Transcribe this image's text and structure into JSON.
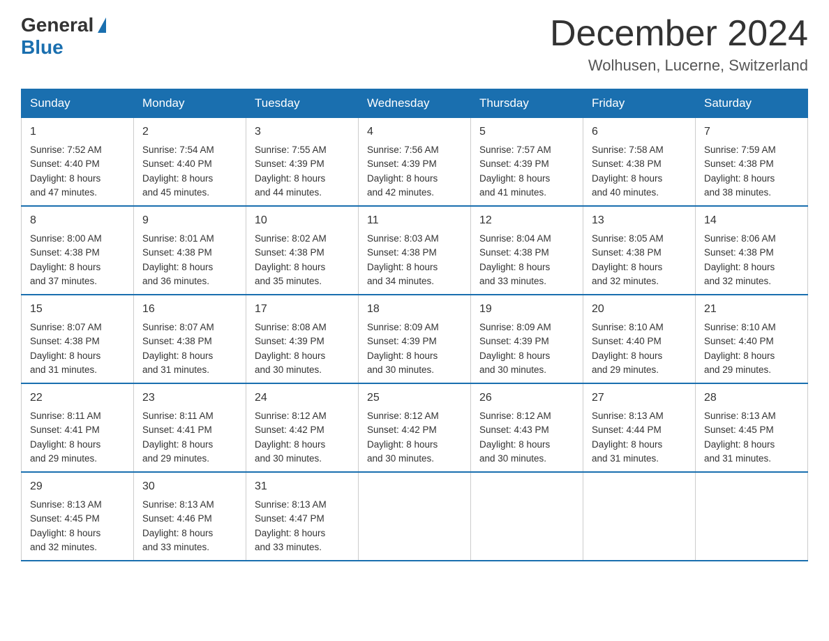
{
  "header": {
    "logo_general": "General",
    "logo_blue": "Blue",
    "title": "December 2024",
    "subtitle": "Wolhusen, Lucerne, Switzerland"
  },
  "weekdays": [
    "Sunday",
    "Monday",
    "Tuesday",
    "Wednesday",
    "Thursday",
    "Friday",
    "Saturday"
  ],
  "weeks": [
    [
      {
        "day": "1",
        "sunrise": "7:52 AM",
        "sunset": "4:40 PM",
        "daylight": "8 hours and 47 minutes."
      },
      {
        "day": "2",
        "sunrise": "7:54 AM",
        "sunset": "4:40 PM",
        "daylight": "8 hours and 45 minutes."
      },
      {
        "day": "3",
        "sunrise": "7:55 AM",
        "sunset": "4:39 PM",
        "daylight": "8 hours and 44 minutes."
      },
      {
        "day": "4",
        "sunrise": "7:56 AM",
        "sunset": "4:39 PM",
        "daylight": "8 hours and 42 minutes."
      },
      {
        "day": "5",
        "sunrise": "7:57 AM",
        "sunset": "4:39 PM",
        "daylight": "8 hours and 41 minutes."
      },
      {
        "day": "6",
        "sunrise": "7:58 AM",
        "sunset": "4:38 PM",
        "daylight": "8 hours and 40 minutes."
      },
      {
        "day": "7",
        "sunrise": "7:59 AM",
        "sunset": "4:38 PM",
        "daylight": "8 hours and 38 minutes."
      }
    ],
    [
      {
        "day": "8",
        "sunrise": "8:00 AM",
        "sunset": "4:38 PM",
        "daylight": "8 hours and 37 minutes."
      },
      {
        "day": "9",
        "sunrise": "8:01 AM",
        "sunset": "4:38 PM",
        "daylight": "8 hours and 36 minutes."
      },
      {
        "day": "10",
        "sunrise": "8:02 AM",
        "sunset": "4:38 PM",
        "daylight": "8 hours and 35 minutes."
      },
      {
        "day": "11",
        "sunrise": "8:03 AM",
        "sunset": "4:38 PM",
        "daylight": "8 hours and 34 minutes."
      },
      {
        "day": "12",
        "sunrise": "8:04 AM",
        "sunset": "4:38 PM",
        "daylight": "8 hours and 33 minutes."
      },
      {
        "day": "13",
        "sunrise": "8:05 AM",
        "sunset": "4:38 PM",
        "daylight": "8 hours and 32 minutes."
      },
      {
        "day": "14",
        "sunrise": "8:06 AM",
        "sunset": "4:38 PM",
        "daylight": "8 hours and 32 minutes."
      }
    ],
    [
      {
        "day": "15",
        "sunrise": "8:07 AM",
        "sunset": "4:38 PM",
        "daylight": "8 hours and 31 minutes."
      },
      {
        "day": "16",
        "sunrise": "8:07 AM",
        "sunset": "4:38 PM",
        "daylight": "8 hours and 31 minutes."
      },
      {
        "day": "17",
        "sunrise": "8:08 AM",
        "sunset": "4:39 PM",
        "daylight": "8 hours and 30 minutes."
      },
      {
        "day": "18",
        "sunrise": "8:09 AM",
        "sunset": "4:39 PM",
        "daylight": "8 hours and 30 minutes."
      },
      {
        "day": "19",
        "sunrise": "8:09 AM",
        "sunset": "4:39 PM",
        "daylight": "8 hours and 30 minutes."
      },
      {
        "day": "20",
        "sunrise": "8:10 AM",
        "sunset": "4:40 PM",
        "daylight": "8 hours and 29 minutes."
      },
      {
        "day": "21",
        "sunrise": "8:10 AM",
        "sunset": "4:40 PM",
        "daylight": "8 hours and 29 minutes."
      }
    ],
    [
      {
        "day": "22",
        "sunrise": "8:11 AM",
        "sunset": "4:41 PM",
        "daylight": "8 hours and 29 minutes."
      },
      {
        "day": "23",
        "sunrise": "8:11 AM",
        "sunset": "4:41 PM",
        "daylight": "8 hours and 29 minutes."
      },
      {
        "day": "24",
        "sunrise": "8:12 AM",
        "sunset": "4:42 PM",
        "daylight": "8 hours and 30 minutes."
      },
      {
        "day": "25",
        "sunrise": "8:12 AM",
        "sunset": "4:42 PM",
        "daylight": "8 hours and 30 minutes."
      },
      {
        "day": "26",
        "sunrise": "8:12 AM",
        "sunset": "4:43 PM",
        "daylight": "8 hours and 30 minutes."
      },
      {
        "day": "27",
        "sunrise": "8:13 AM",
        "sunset": "4:44 PM",
        "daylight": "8 hours and 31 minutes."
      },
      {
        "day": "28",
        "sunrise": "8:13 AM",
        "sunset": "4:45 PM",
        "daylight": "8 hours and 31 minutes."
      }
    ],
    [
      {
        "day": "29",
        "sunrise": "8:13 AM",
        "sunset": "4:45 PM",
        "daylight": "8 hours and 32 minutes."
      },
      {
        "day": "30",
        "sunrise": "8:13 AM",
        "sunset": "4:46 PM",
        "daylight": "8 hours and 33 minutes."
      },
      {
        "day": "31",
        "sunrise": "8:13 AM",
        "sunset": "4:47 PM",
        "daylight": "8 hours and 33 minutes."
      },
      null,
      null,
      null,
      null
    ]
  ],
  "labels": {
    "sunrise": "Sunrise:",
    "sunset": "Sunset:",
    "daylight": "Daylight:"
  }
}
